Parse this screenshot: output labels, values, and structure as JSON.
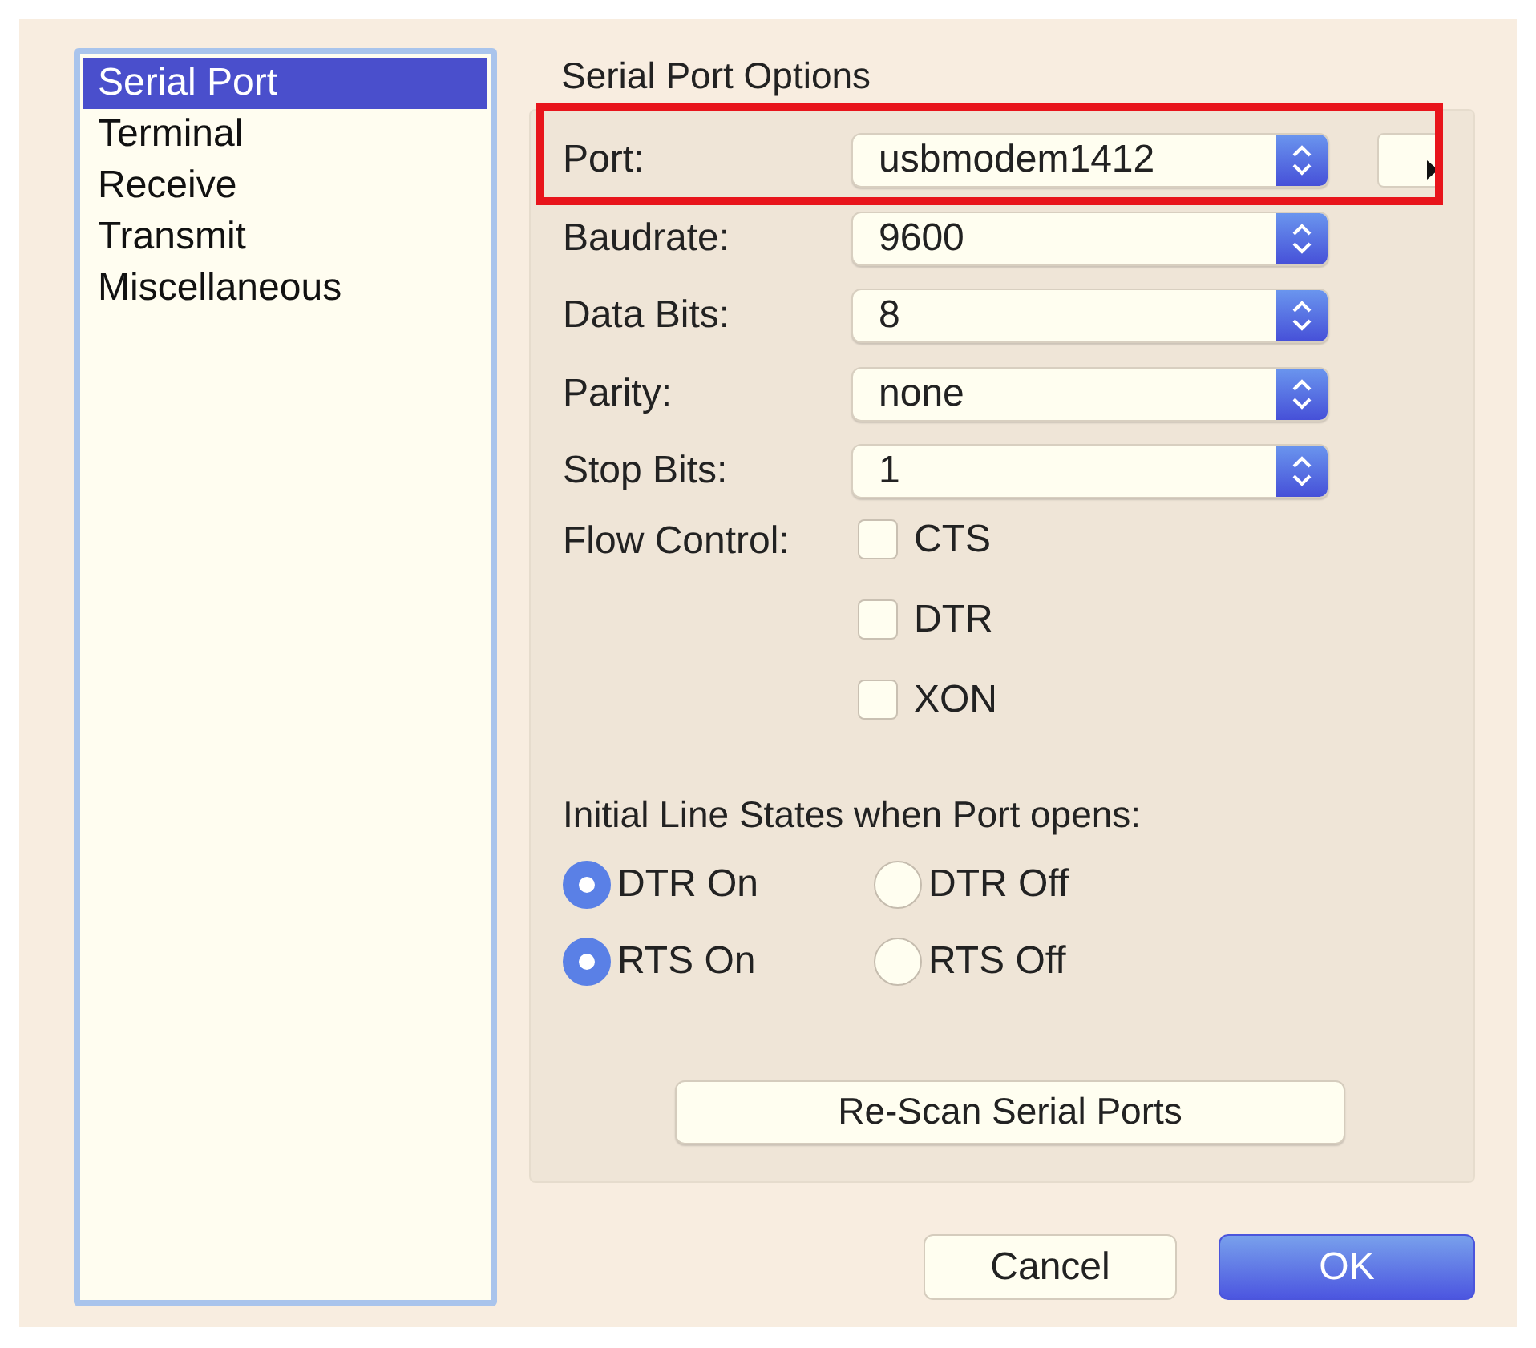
{
  "sidebar": {
    "items": [
      {
        "label": "Serial Port",
        "selected": true
      },
      {
        "label": "Terminal",
        "selected": false
      },
      {
        "label": "Receive",
        "selected": false
      },
      {
        "label": "Transmit",
        "selected": false
      },
      {
        "label": "Miscellaneous",
        "selected": false
      }
    ]
  },
  "options": {
    "title": "Serial Port Options",
    "fields": [
      {
        "label": "Port:",
        "value": "usbmodem1412",
        "highlighted": true
      },
      {
        "label": "Baudrate:",
        "value": "9600",
        "highlighted": false
      },
      {
        "label": "Data Bits:",
        "value": "8",
        "highlighted": false
      },
      {
        "label": "Parity:",
        "value": "none",
        "highlighted": false
      },
      {
        "label": "Stop Bits:",
        "value": "1",
        "highlighted": false
      }
    ],
    "flow_control": {
      "label": "Flow Control:",
      "items": [
        {
          "label": "CTS",
          "checked": false
        },
        {
          "label": "DTR",
          "checked": false
        },
        {
          "label": "XON",
          "checked": false
        }
      ]
    },
    "line_states": {
      "label": "Initial Line States when Port opens:",
      "groups": [
        [
          {
            "label": "DTR On",
            "selected": true
          },
          {
            "label": "DTR Off",
            "selected": false
          }
        ],
        [
          {
            "label": "RTS On",
            "selected": true
          },
          {
            "label": "RTS Off",
            "selected": false
          }
        ]
      ]
    },
    "rescan_button": "Re-Scan Serial Ports"
  },
  "buttons": [
    {
      "label": "Cancel",
      "kind": "secondary"
    },
    {
      "label": "OK",
      "kind": "primary"
    }
  ]
}
